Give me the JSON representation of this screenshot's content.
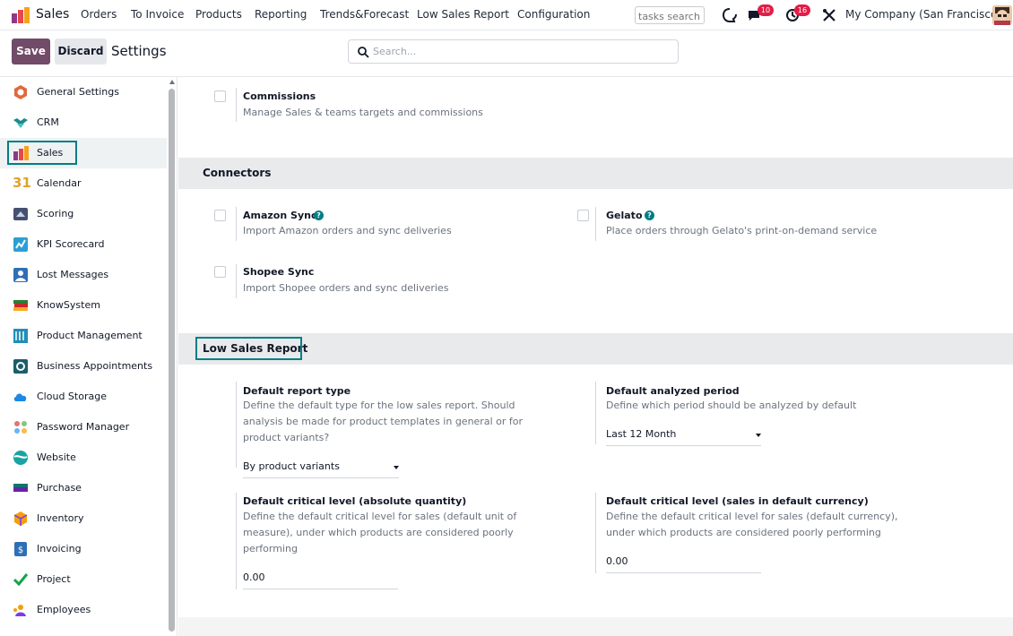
{
  "navbar": {
    "app_name": "Sales",
    "menu": [
      "Orders",
      "To Invoice",
      "Products",
      "Reporting",
      "Trends&Forecast",
      "Low Sales Report",
      "Configuration"
    ],
    "tasks_search_placeholder": "tasks search",
    "messages_badge": "10",
    "activities_badge": "16",
    "company": "My Company (San Francisco)"
  },
  "control_panel": {
    "save_label": "Save",
    "discard_label": "Discard",
    "title": "Settings",
    "search_placeholder": "Search..."
  },
  "sidebar": {
    "items": [
      {
        "label": "General Settings",
        "icon": "general-settings-icon"
      },
      {
        "label": "CRM",
        "icon": "crm-icon"
      },
      {
        "label": "Sales",
        "icon": "sales-icon",
        "active": true
      },
      {
        "label": "Calendar",
        "icon": "calendar-icon"
      },
      {
        "label": "Scoring",
        "icon": "scoring-icon"
      },
      {
        "label": "KPI Scorecard",
        "icon": "kpi-icon"
      },
      {
        "label": "Lost Messages",
        "icon": "lost-messages-icon"
      },
      {
        "label": "KnowSystem",
        "icon": "books-icon"
      },
      {
        "label": "Product Management",
        "icon": "product-management-icon"
      },
      {
        "label": "Business Appointments",
        "icon": "appointments-icon"
      },
      {
        "label": "Cloud Storage",
        "icon": "cloud-icon"
      },
      {
        "label": "Password Manager",
        "icon": "password-icon"
      },
      {
        "label": "Website",
        "icon": "website-icon"
      },
      {
        "label": "Purchase",
        "icon": "purchase-icon"
      },
      {
        "label": "Inventory",
        "icon": "inventory-icon"
      },
      {
        "label": "Invoicing",
        "icon": "invoicing-icon"
      },
      {
        "label": "Project",
        "icon": "project-icon"
      },
      {
        "label": "Employees",
        "icon": "employees-icon"
      }
    ],
    "calendar_day": "31"
  },
  "content": {
    "commissions": {
      "title": "Commissions",
      "desc": "Manage Sales & teams targets and commissions"
    },
    "connectors": {
      "heading": "Connectors",
      "amazon": {
        "title": "Amazon Sync",
        "desc": "Import Amazon orders and sync deliveries"
      },
      "gelato": {
        "title": "Gelato",
        "desc": "Place orders through Gelato's print-on-demand service"
      },
      "shopee": {
        "title": "Shopee Sync",
        "desc": "Import Shopee orders and sync deliveries"
      }
    },
    "low_sales": {
      "heading": "Low Sales Report",
      "report_type": {
        "title": "Default report type",
        "desc": "Define the default type for the low sales report. Should analysis be made for product templates in general or for product variants?",
        "value": "By product variants"
      },
      "analyzed_period": {
        "title": "Default analyzed period",
        "desc": "Define which period should be analyzed by default",
        "value": "Last 12 Month"
      },
      "critical_qty": {
        "title": "Default critical level (absolute quantity)",
        "desc": "Define the default critical level for sales (default unit of measure), under which products are considered poorly performing",
        "value": "0.00"
      },
      "critical_currency": {
        "title": "Default critical level (sales in default currency)",
        "desc": "Define the default critical level for sales (default currency), under which products are considered poorly performing",
        "value": "0.00"
      }
    }
  },
  "colors": {
    "primary": "#714b67",
    "accent": "#017e84",
    "badge": "#e11d48"
  }
}
